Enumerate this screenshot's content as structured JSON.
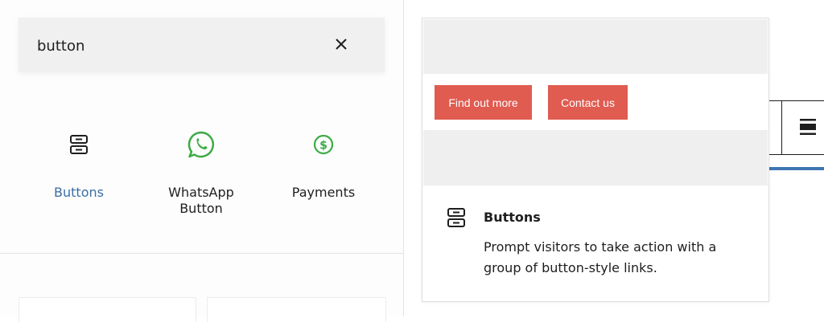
{
  "search": {
    "value": "button",
    "clear_icon": "close-icon"
  },
  "blocks": [
    {
      "label": "Buttons",
      "icon": "buttons-icon",
      "color": "#3b6ea5"
    },
    {
      "label": "WhatsApp Button",
      "icon": "whatsapp-icon",
      "color": "#3cab45"
    },
    {
      "label": "Payments",
      "icon": "dollar-circle-icon",
      "color": "#3cab45"
    }
  ],
  "preview": {
    "buttons": [
      "Find out more",
      "Contact us"
    ],
    "button_color": "#e05b50",
    "title": "Buttons",
    "description": "Prompt visitors to take action with a group of button-style links."
  },
  "toolbar": {
    "align_icon": "align-icon",
    "accent": "#3e75b2"
  }
}
